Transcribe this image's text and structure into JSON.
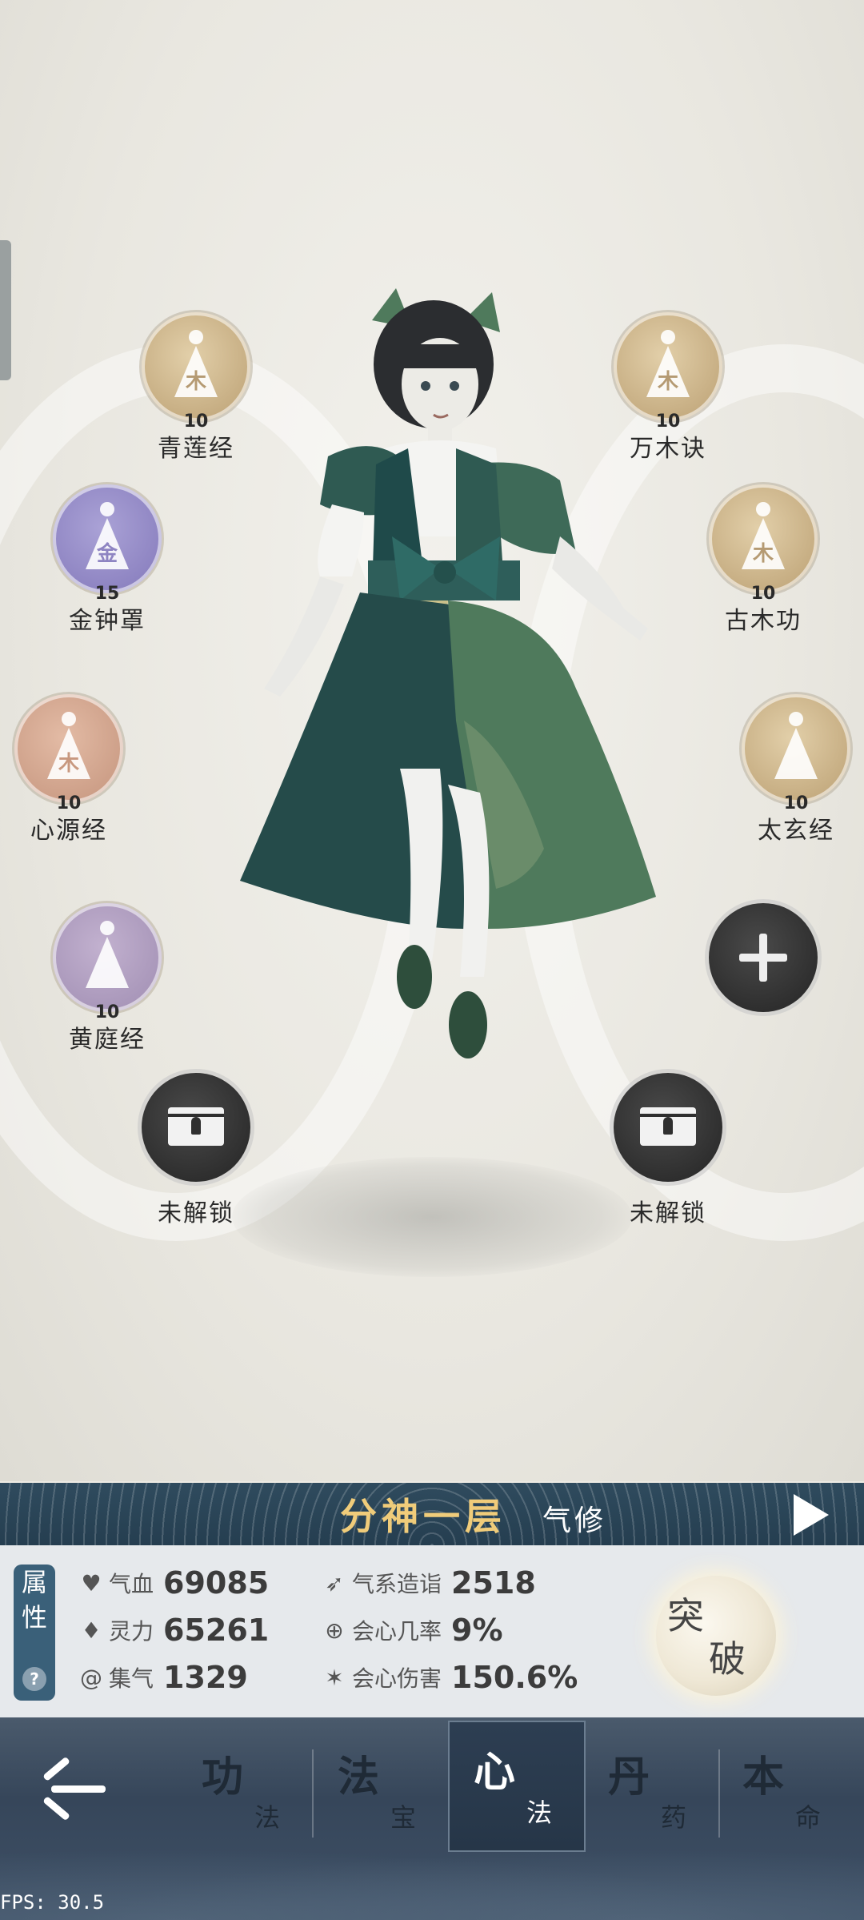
{
  "skills_left": [
    {
      "name": "青莲经",
      "level": "10",
      "glyph": "木",
      "color": "gold"
    },
    {
      "name": "金钟罩",
      "level": "15",
      "glyph": "金",
      "color": "purple"
    },
    {
      "name": "心源经",
      "level": "10",
      "glyph": "木",
      "color": "rose"
    },
    {
      "name": "黄庭经",
      "level": "10",
      "glyph": "",
      "color": "lilac"
    }
  ],
  "skills_right": [
    {
      "name": "万木诀",
      "level": "10",
      "glyph": "木",
      "color": "gold"
    },
    {
      "name": "古木功",
      "level": "10",
      "glyph": "木",
      "color": "gold"
    },
    {
      "name": "太玄经",
      "level": "10",
      "glyph": "",
      "color": "gold"
    }
  ],
  "locked_slots": [
    {
      "label": "未解锁"
    },
    {
      "label": "未解锁"
    }
  ],
  "realm": {
    "title": "分神一层",
    "type": "气修"
  },
  "stats_tab": {
    "line1": "属",
    "line2": "性",
    "help": "?"
  },
  "stats": {
    "hp": {
      "label": "气血",
      "value": "69085",
      "icon": "heart-icon"
    },
    "spirit": {
      "label": "灵力",
      "value": "65261",
      "icon": "flame-icon"
    },
    "gather": {
      "label": "集气",
      "value": "1329",
      "icon": "swirl-icon"
    },
    "qi_mastery": {
      "label": "气系造诣",
      "value": "2518",
      "icon": "wing-icon"
    },
    "crit_rate": {
      "label": "会心几率",
      "value": "9%",
      "icon": "crit-rate-icon"
    },
    "crit_damage": {
      "label": "会心伤害",
      "value": "150.6%",
      "icon": "burst-icon"
    }
  },
  "breakthrough": {
    "char1": "突",
    "char2": "破"
  },
  "nav": {
    "tabs": [
      {
        "big": "功",
        "small": "法"
      },
      {
        "big": "法",
        "small": "宝"
      },
      {
        "big": "心",
        "small": "法"
      },
      {
        "big": "丹",
        "small": "药"
      },
      {
        "big": "本",
        "small": "命"
      }
    ],
    "active_index": 2
  },
  "fps": "FPS: 30.5"
}
